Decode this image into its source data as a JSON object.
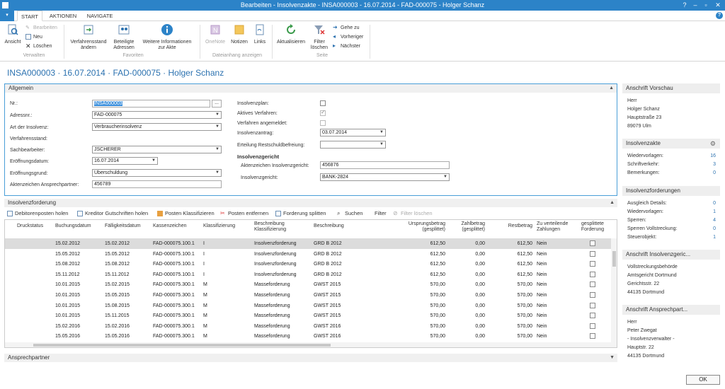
{
  "window": {
    "title": "Bearbeiten - Insolvenzakte - INSA000003 - 16.07.2014 - FAD-000075 - Holger Schanz"
  },
  "tabs": [
    "START",
    "AKTIONEN",
    "NAVIGATE"
  ],
  "ribbon": {
    "groups": [
      "Verwalten",
      "Favoriten",
      "Dateianhang anzeigen",
      "Seite"
    ],
    "ansicht": "Ansicht",
    "bearbeiten": "Bearbeiten",
    "neu": "Neu",
    "loeschen": "Löschen",
    "verfahrensstand": "Verfahrensstand ändern",
    "beteiligte": "Beteiligte Adressen",
    "weitere": "Weitere Informationen zur Akte",
    "onenote": "OneNote",
    "notizen": "Notizen",
    "links": "Links",
    "aktualisieren": "Aktualisieren",
    "filter_loeschen": "Filter löschen",
    "gehe_zu": "Gehe zu",
    "vorheriger": "Vorheriger",
    "naechster": "Nächster"
  },
  "page_title": "INSA000003 · 16.07.2014 · FAD-000075 · Holger Schanz",
  "allgemein": {
    "header": "Allgemein",
    "nr_label": "Nr.:",
    "nr_value": "INSA000003",
    "adressnr_label": "Adressnr.:",
    "adressnr_value": "FAD-000075",
    "art_label": "Art der Insolvenz:",
    "art_value": "Verbraucherinsolvenz",
    "verfahrensstand_label": "Verfahrensstand:",
    "sachbearbeiter_label": "Sachbearbeiter:",
    "sachbearbeiter_value": "JSCHERER",
    "eroeffnungsdatum_label": "Eröffnungsdatum:",
    "eroeffnungsdatum_value": "16.07.2014",
    "eroeffnungsgrund_label": "Eröffnungsgrund:",
    "eroeffnungsgrund_value": "Überschuldung",
    "az_ansprech_label": "Aktenzeichen Ansprechpartner:",
    "az_ansprech_value": "456789",
    "insolvenzplan_label": "Insolvenzplan:",
    "aktives_label": "Aktives Verfahren:",
    "angemeldet_label": "Verfahren angemeldet:",
    "antrag_label": "Insolvenzantrag:",
    "antrag_value": "03.07.2014",
    "erteilung_label": "Erteilung Restschuldbefreiung:",
    "erteilung_value": "",
    "gericht_head": "Insolvenzgericht",
    "az_gericht_label": "Aktenzeichen Insolvenzgericht:",
    "az_gericht_value": "456876",
    "gericht_label": "Insolvenzgericht:",
    "gericht_value": "BANK-2824"
  },
  "forderung": {
    "header": "Insolvenzforderung",
    "toolbar": [
      "Debitorenposten holen",
      "Kreditor Gutschriften holen",
      "Posten Klassifizieren",
      "Posten entfernen",
      "Forderung splitten",
      "Suchen",
      "Filter",
      "Filter löschen"
    ],
    "columns": [
      "Druckstatus",
      "Buchungsdatum",
      "Fälligkeitsdatum",
      "Kassenzeichen",
      "Klassifizierung",
      "Beschreibung Klassifizierung",
      "Beschreibung",
      "Ursprungsbetrag (gesplittet)",
      "Zahlbetrag (gesplittet)",
      "Restbetrag",
      "Zu verteilende Zahlungen",
      "gesplittete Forderung"
    ],
    "rows": [
      [
        "",
        "15.02.2012",
        "15.02.2012",
        "FAD-000075.100.1",
        "I",
        "Insolvenzforderung",
        "GRD B 2012",
        "612,50",
        "0,00",
        "612,50",
        "Nein"
      ],
      [
        "",
        "15.05.2012",
        "15.05.2012",
        "FAD-000075.100.1",
        "I",
        "Insolvenzforderung",
        "GRD B 2012",
        "612,50",
        "0,00",
        "612,50",
        "Nein"
      ],
      [
        "",
        "15.08.2012",
        "15.08.2012",
        "FAD-000075.100.1",
        "I",
        "Insolvenzforderung",
        "GRD B 2012",
        "612,50",
        "0,00",
        "612,50",
        "Nein"
      ],
      [
        "",
        "15.11.2012",
        "15.11.2012",
        "FAD-000075.100.1",
        "I",
        "Insolvenzforderung",
        "GRD B 2012",
        "612,50",
        "0,00",
        "612,50",
        "Nein"
      ],
      [
        "",
        "10.01.2015",
        "15.02.2015",
        "FAD-000075.300.1",
        "M",
        "Masseforderung",
        "GWST 2015",
        "570,00",
        "0,00",
        "570,00",
        "Nein"
      ],
      [
        "",
        "10.01.2015",
        "15.05.2015",
        "FAD-000075.300.1",
        "M",
        "Masseforderung",
        "GWST 2015",
        "570,00",
        "0,00",
        "570,00",
        "Nein"
      ],
      [
        "",
        "10.01.2015",
        "15.08.2015",
        "FAD-000075.300.1",
        "M",
        "Masseforderung",
        "GWST 2015",
        "570,00",
        "0,00",
        "570,00",
        "Nein"
      ],
      [
        "",
        "10.01.2015",
        "15.11.2015",
        "FAD-000075.300.1",
        "M",
        "Masseforderung",
        "GWST 2015",
        "570,00",
        "0,00",
        "570,00",
        "Nein"
      ],
      [
        "",
        "15.02.2016",
        "15.02.2016",
        "FAD-000075.300.1",
        "M",
        "Masseforderung",
        "GWST 2016",
        "570,00",
        "0,00",
        "570,00",
        "Nein"
      ],
      [
        "",
        "15.05.2016",
        "15.05.2016",
        "FAD-000075.300.1",
        "M",
        "Masseforderung",
        "GWST 2016",
        "570,00",
        "0,00",
        "570,00",
        "Nein"
      ]
    ]
  },
  "ansprechpartner": {
    "header": "Ansprechpartner"
  },
  "factbox": {
    "vorschau": {
      "header": "Anschrift Vorschau",
      "lines": [
        "Herr",
        "Holger Schanz",
        "Hauptstraße 23",
        "89079 Ulm"
      ]
    },
    "akte": {
      "header": "Insolvenzakte",
      "items": [
        {
          "label": "Wiedervorlagen:",
          "value": "16"
        },
        {
          "label": "Schriftverkehr:",
          "value": "3"
        },
        {
          "label": "Bemerkungen:",
          "value": "0"
        }
      ]
    },
    "forderungen": {
      "header": "Insolvenzforderungen",
      "items": [
        {
          "label": "Ausgleich Details:",
          "value": "0"
        },
        {
          "label": "Wiedervorlagen:",
          "value": "1"
        },
        {
          "label": "Sperren:",
          "value": "4"
        },
        {
          "label": "Sperren Vollstreckung:",
          "value": "0"
        },
        {
          "label": "Steuerobjekt:",
          "value": "1"
        }
      ]
    },
    "gericht": {
      "header": "Anschrift Insolvenzgeric...",
      "lines": [
        "Vollstreckungsbehörde",
        "Amtsgericht Dortmund",
        "Gerichtsstr. 22",
        "44135 Dortmund"
      ]
    },
    "ansprech": {
      "header": "Anschrift Ansprechpart...",
      "lines": [
        "Herr",
        "Peter Zwegat",
        "- Insolvenzverwalter -",
        "Hauptstr. 22",
        "44135 Dortmund"
      ]
    }
  },
  "ok_label": "OK"
}
